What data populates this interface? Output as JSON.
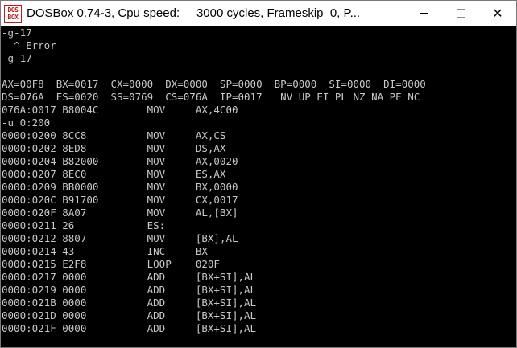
{
  "window": {
    "title": "DOSBox 0.74-3, Cpu speed:     3000 cycles, Frameskip  0, P...",
    "icon_text": [
      "DOS",
      "BOX"
    ],
    "icon": "dosbox-app-icon",
    "buttons": {
      "minimize": "minimize-icon",
      "maximize": "maximize-icon",
      "close": "✕"
    }
  },
  "terminal": {
    "lines": [
      "-g-17",
      "  ^ Error",
      "-g 17",
      "",
      "AX=00F8  BX=0017  CX=0000  DX=0000  SP=0000  BP=0000  SI=0000  DI=0000",
      "DS=076A  ES=0020  SS=0769  CS=076A  IP=0017   NV UP EI PL NZ NA PE NC",
      "076A:0017 B8004C        MOV     AX,4C00",
      "-u 0:200",
      "0000:0200 8CC8          MOV     AX,CS",
      "0000:0202 8ED8          MOV     DS,AX",
      "0000:0204 B82000        MOV     AX,0020",
      "0000:0207 8EC0          MOV     ES,AX",
      "0000:0209 BB0000        MOV     BX,0000",
      "0000:020C B91700        MOV     CX,0017",
      "0000:020F 8A07          MOV     AL,[BX]",
      "0000:0211 26            ES:",
      "0000:0212 8807          MOV     [BX],AL",
      "0000:0214 43            INC     BX",
      "0000:0215 E2F8          LOOP    020F",
      "0000:0217 0000          ADD     [BX+SI],AL",
      "0000:0219 0000          ADD     [BX+SI],AL",
      "0000:021B 0000          ADD     [BX+SI],AL",
      "0000:021D 0000          ADD     [BX+SI],AL",
      "0000:021F 0000          ADD     [BX+SI],AL",
      "-"
    ],
    "colors": {
      "background": "#000000",
      "foreground": "#c8c8c8"
    }
  }
}
